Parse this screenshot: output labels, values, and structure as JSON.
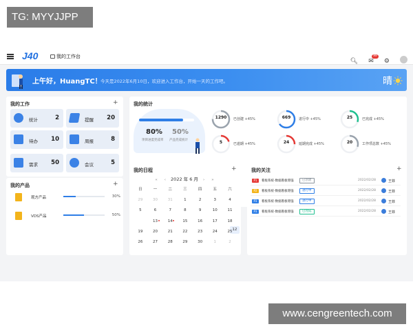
{
  "watermark_top": "TG: MYYJJPP",
  "watermark_bottom": "www.cengreentech.com",
  "header": {
    "logo": "J40",
    "workspace": "我的工作台",
    "mail_badge": "99"
  },
  "banner": {
    "greeting": "上午好，HuangTC！",
    "subtext": "今天是2022年6月10日，欢迎进入工作台，开始一天的工作吧。",
    "weather": "晴"
  },
  "my_work": {
    "title": "我的工作",
    "tiles": [
      {
        "label": "统计",
        "value": "2"
      },
      {
        "label": "提醒",
        "value": "20"
      },
      {
        "label": "待办",
        "value": "10"
      },
      {
        "label": "周报",
        "value": "8"
      },
      {
        "label": "需求",
        "value": "50"
      },
      {
        "label": "会议",
        "value": "5"
      }
    ]
  },
  "my_products": {
    "title": "我的产品",
    "items": [
      {
        "name": "观方产品",
        "percent_label": "30%",
        "progress": 0.3
      },
      {
        "name": "VDS产品",
        "percent_label": "50%",
        "progress": 0.5
      }
    ]
  },
  "my_stats": {
    "title": "我的统计",
    "big1_value": "80%",
    "big1_label": "项目进度完成率",
    "big2_value": "50%",
    "big2_label": "产品完成统计",
    "rings": [
      {
        "value": "1290",
        "label": "已创建",
        "delta": "+45%",
        "color": "#9aa3ad",
        "fraction": 0.75
      },
      {
        "value": "669",
        "label": "进行中",
        "delta": "+45%",
        "color": "#2e7ee6",
        "fraction": 0.65
      },
      {
        "value": "25",
        "label": "已完成",
        "delta": "+45%",
        "color": "#1fbf8f",
        "fraction": 0.3
      },
      {
        "value": "5",
        "label": "已逾期",
        "delta": "+45%",
        "color": "#e53935",
        "fraction": 0.2
      },
      {
        "value": "24",
        "label": "延期完成",
        "delta": "+45%",
        "color": "#e53935",
        "fraction": 0.25
      },
      {
        "value": "20",
        "label": "工作项总数",
        "delta": "+45%",
        "color": "#9aa3ad",
        "fraction": 0.3
      }
    ]
  },
  "schedule": {
    "title": "我的日程",
    "month": "2022 年 6 月",
    "weekdays": [
      "日",
      "一",
      "二",
      "三",
      "四",
      "五",
      "六"
    ],
    "weeks": [
      [
        "29",
        "30",
        "31",
        "1",
        "2",
        "3",
        "4"
      ],
      [
        "5",
        "6",
        "7",
        "8",
        "9",
        "10",
        "11"
      ],
      [
        "12",
        "13",
        "14",
        "15",
        "16",
        "17",
        "18"
      ],
      [
        "19",
        "20",
        "21",
        "22",
        "23",
        "24",
        "25"
      ],
      [
        "26",
        "27",
        "28",
        "29",
        "30",
        "1",
        "2"
      ]
    ]
  },
  "focus": {
    "title": "我的关注",
    "rows": [
      {
        "priority": "P1",
        "pcolor": "#e53935",
        "text": "看板系统-数据看板增强",
        "status": "已创建",
        "scolor": "#8a939c",
        "date": "2022/02/28",
        "user": "王菲"
      },
      {
        "priority": "P2",
        "pcolor": "#f3b41b",
        "text": "看板系统-数据看板增强",
        "status": "进行中",
        "scolor": "#2e7ee6",
        "date": "2022/02/28",
        "user": "王菲"
      },
      {
        "priority": "P3",
        "pcolor": "#2e7ee6",
        "text": "看板系统-数据看板增强",
        "status": "进行中",
        "scolor": "#2e7ee6",
        "date": "2022/02/28",
        "user": "王菲"
      },
      {
        "priority": "P3",
        "pcolor": "#2e7ee6",
        "text": "看板系统-数据看板增强",
        "status": "已完成",
        "scolor": "#1fbf8f",
        "date": "2022/02/28",
        "user": "王菲"
      }
    ]
  }
}
